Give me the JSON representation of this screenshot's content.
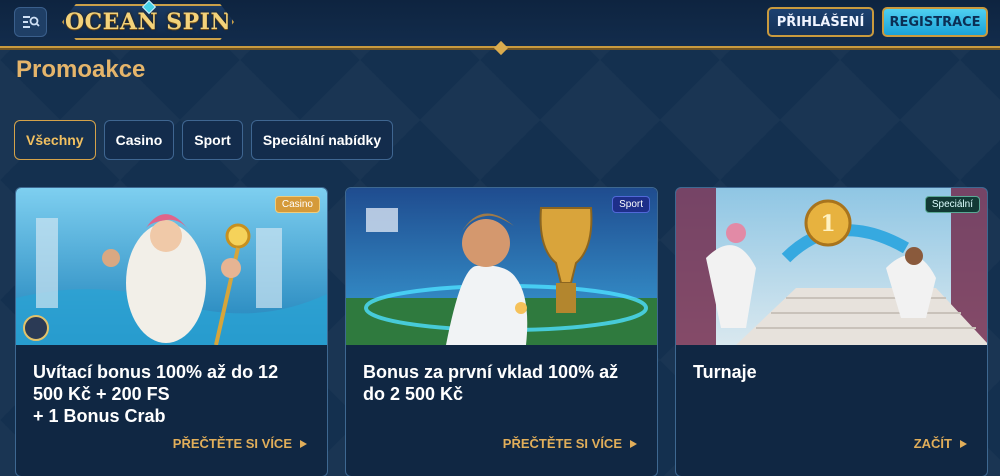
{
  "header": {
    "logo_text": "OCEAN SPIN",
    "login_label": "PŘIHLÁŠENÍ",
    "register_label": "REGISTRACE"
  },
  "page_title": "Promoakce",
  "filters": [
    {
      "label": "Všechny",
      "active": true
    },
    {
      "label": "Casino",
      "active": false
    },
    {
      "label": "Sport",
      "active": false
    },
    {
      "label": "Speciální nabídky",
      "active": false
    }
  ],
  "cards": [
    {
      "badge": "Casino",
      "title_lines": [
        "Uvítací bonus 100% až do 12",
        "500 Kč + 200 FS",
        "+ 1 Bonus Crab"
      ],
      "link": "PŘEČTĚTE SI VÍCE"
    },
    {
      "badge": "Sport",
      "title_lines": [
        "Bonus za první vklad 100% až",
        "do 2 500 Kč"
      ],
      "link": "PŘEČTĚTE SI VÍCE"
    },
    {
      "badge": "Speciální",
      "title_lines": [
        "Turnaje"
      ],
      "link": "ZAČÍT"
    }
  ],
  "icons": {
    "menu": "menu-search-icon",
    "link_arrow": "triangle-right-icon"
  },
  "colors": {
    "accent_gold": "#e1ae5a",
    "background": "#14304f",
    "register_cyan": "#2ab8e8"
  }
}
